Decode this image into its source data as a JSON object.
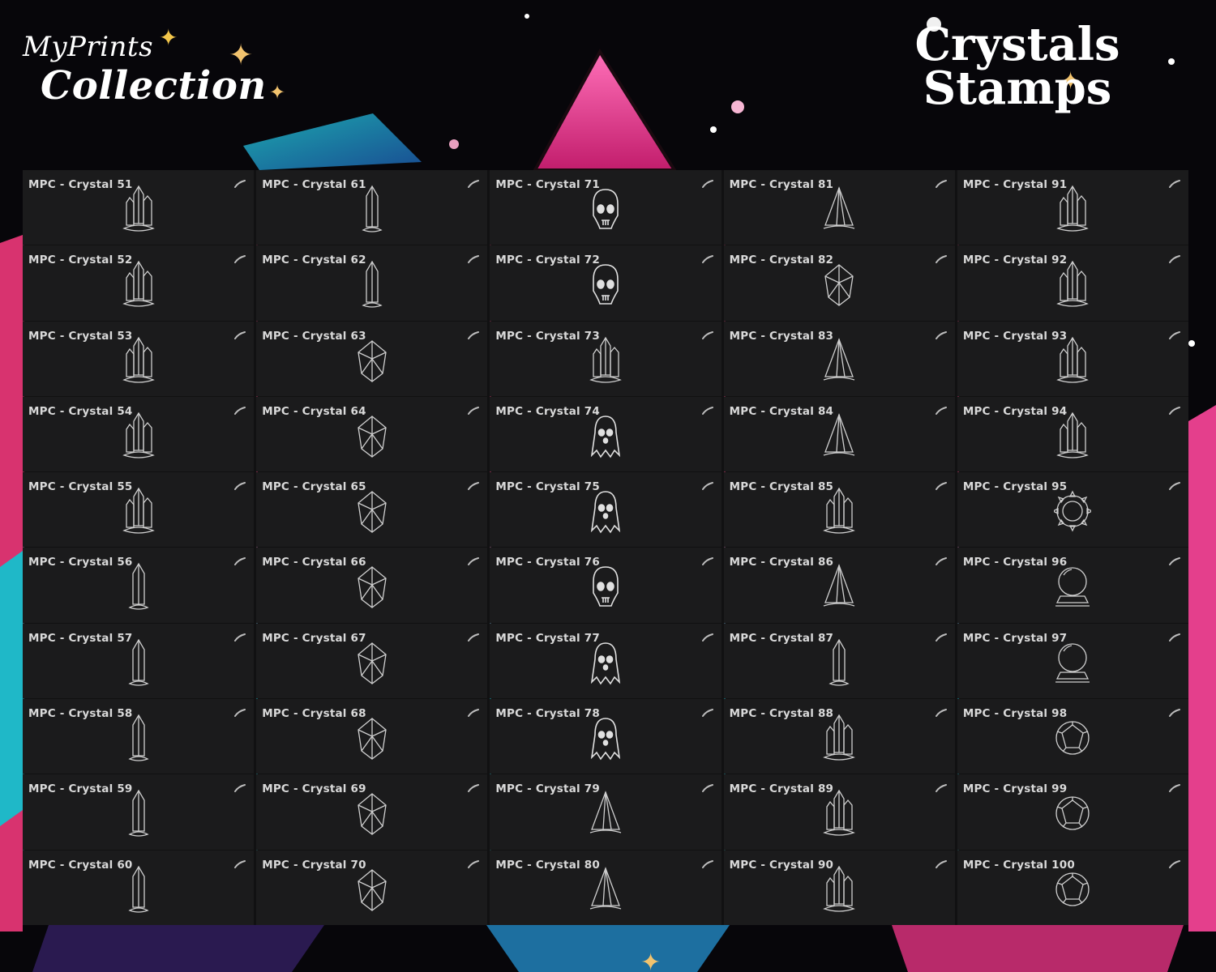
{
  "brand": {
    "line1": "MyPrints",
    "line2": "Collection"
  },
  "title": {
    "line1": "Crystals",
    "line2": "Stamps"
  },
  "columns": [
    {
      "items": [
        {
          "label": "MPC - Crystal 51",
          "icon": "crystal-cluster-icon"
        },
        {
          "label": "MPC - Crystal 52",
          "icon": "crystal-cluster-icon"
        },
        {
          "label": "MPC - Crystal 53",
          "icon": "crystal-cluster-icon"
        },
        {
          "label": "MPC - Crystal 54",
          "icon": "crystal-cluster-icon"
        },
        {
          "label": "MPC - Crystal 55",
          "icon": "crystal-cluster-icon"
        },
        {
          "label": "MPC - Crystal 56",
          "icon": "crystal-point-icon"
        },
        {
          "label": "MPC - Crystal 57",
          "icon": "crystal-point-icon"
        },
        {
          "label": "MPC - Crystal 58",
          "icon": "crystal-point-icon"
        },
        {
          "label": "MPC - Crystal 59",
          "icon": "crystal-point-icon"
        },
        {
          "label": "MPC - Crystal 60",
          "icon": "crystal-point-icon"
        }
      ]
    },
    {
      "items": [
        {
          "label": "MPC - Crystal 61",
          "icon": "crystal-point-icon"
        },
        {
          "label": "MPC - Crystal 62",
          "icon": "crystal-point-icon"
        },
        {
          "label": "MPC - Crystal 63",
          "icon": "gem-icon"
        },
        {
          "label": "MPC - Crystal 64",
          "icon": "gem-icon"
        },
        {
          "label": "MPC - Crystal 65",
          "icon": "gem-icon"
        },
        {
          "label": "MPC - Crystal 66",
          "icon": "gem-icon"
        },
        {
          "label": "MPC - Crystal 67",
          "icon": "gem-icon"
        },
        {
          "label": "MPC - Crystal 68",
          "icon": "gem-icon"
        },
        {
          "label": "MPC - Crystal 69",
          "icon": "gem-icon"
        },
        {
          "label": "MPC - Crystal 70",
          "icon": "gem-icon"
        }
      ]
    },
    {
      "items": [
        {
          "label": "MPC - Crystal 71",
          "icon": "skull-icon"
        },
        {
          "label": "MPC - Crystal 72",
          "icon": "skull-icon"
        },
        {
          "label": "MPC - Crystal 73",
          "icon": "crystal-cluster-icon"
        },
        {
          "label": "MPC - Crystal 74",
          "icon": "ghost-icon"
        },
        {
          "label": "MPC - Crystal 75",
          "icon": "ghost-icon"
        },
        {
          "label": "MPC - Crystal 76",
          "icon": "skull-icon"
        },
        {
          "label": "MPC - Crystal 77",
          "icon": "ghost-icon"
        },
        {
          "label": "MPC - Crystal 78",
          "icon": "ghost-icon"
        },
        {
          "label": "MPC - Crystal 79",
          "icon": "pyramid-icon"
        },
        {
          "label": "MPC - Crystal 80",
          "icon": "pyramid-icon"
        }
      ]
    },
    {
      "items": [
        {
          "label": "MPC - Crystal 81",
          "icon": "pyramid-icon"
        },
        {
          "label": "MPC - Crystal 82",
          "icon": "gem-icon"
        },
        {
          "label": "MPC - Crystal 83",
          "icon": "pyramid-icon"
        },
        {
          "label": "MPC - Crystal 84",
          "icon": "pyramid-icon"
        },
        {
          "label": "MPC - Crystal 85",
          "icon": "crystal-cluster-icon"
        },
        {
          "label": "MPC - Crystal 86",
          "icon": "pyramid-icon"
        },
        {
          "label": "MPC - Crystal 87",
          "icon": "crystal-point-icon"
        },
        {
          "label": "MPC - Crystal 88",
          "icon": "crystal-cluster-icon"
        },
        {
          "label": "MPC - Crystal 89",
          "icon": "crystal-cluster-icon"
        },
        {
          "label": "MPC - Crystal 90",
          "icon": "crystal-cluster-icon"
        }
      ]
    },
    {
      "items": [
        {
          "label": "MPC - Crystal 91",
          "icon": "crystal-cluster-icon"
        },
        {
          "label": "MPC - Crystal 92",
          "icon": "crystal-cluster-icon"
        },
        {
          "label": "MPC - Crystal 93",
          "icon": "crystal-cluster-icon"
        },
        {
          "label": "MPC - Crystal 94",
          "icon": "crystal-cluster-icon"
        },
        {
          "label": "MPC - Crystal 95",
          "icon": "sun-gem-icon"
        },
        {
          "label": "MPC - Crystal 96",
          "icon": "crystal-ball-icon"
        },
        {
          "label": "MPC - Crystal 97",
          "icon": "crystal-ball-icon"
        },
        {
          "label": "MPC - Crystal 98",
          "icon": "faceted-sphere-icon"
        },
        {
          "label": "MPC - Crystal 99",
          "icon": "faceted-sphere-icon"
        },
        {
          "label": "MPC - Crystal 100",
          "icon": "faceted-sphere-icon"
        }
      ]
    }
  ]
}
